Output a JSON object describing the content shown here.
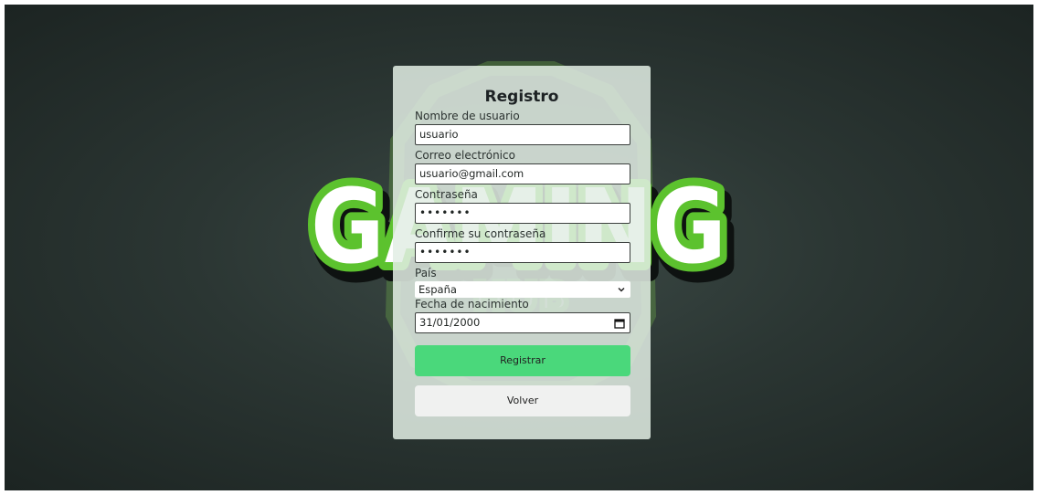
{
  "background": {
    "logo_text": "GAMING",
    "logo_subtext": "HUB",
    "accent_color": "#5cc22e",
    "bg_color": "#2b3633"
  },
  "form": {
    "title": "Registro",
    "username": {
      "label": "Nombre de usuario",
      "value": "usuario"
    },
    "email": {
      "label": "Correo electrónico",
      "value": "usuario@gmail.com"
    },
    "password": {
      "label": "Contraseña",
      "value": "•••••••"
    },
    "confirm_password": {
      "label": "Confirme su contraseña",
      "value": "•••••••"
    },
    "country": {
      "label": "País",
      "value": "España"
    },
    "birthdate": {
      "label": "Fecha de nacimiento",
      "value": "31/01/2000"
    },
    "submit_label": "Registrar",
    "back_label": "Volver",
    "submit_color": "#4ad87b"
  }
}
